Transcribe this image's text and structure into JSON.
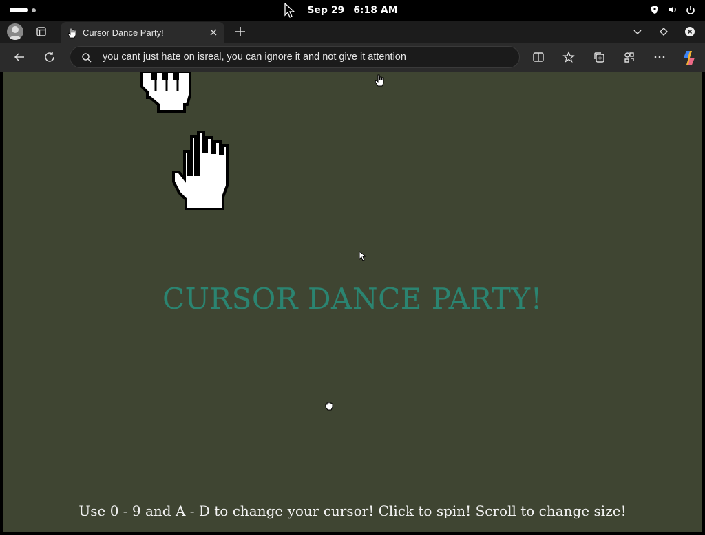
{
  "system_bar": {
    "date": "Sep 29",
    "time": "6:18 AM"
  },
  "browser": {
    "tab": {
      "title": "Cursor Dance Party!"
    },
    "address_bar": {
      "value": "you cant just hate on isreal, you can ignore it and not give it attention"
    }
  },
  "page": {
    "title": "CURSOR DANCE PARTY!",
    "instructions": "Use 0 - 9 and A - D to change your cursor! Click to spin! Scroll to change size!",
    "title_color": "#2b8471",
    "background_color": "#3f4532"
  }
}
